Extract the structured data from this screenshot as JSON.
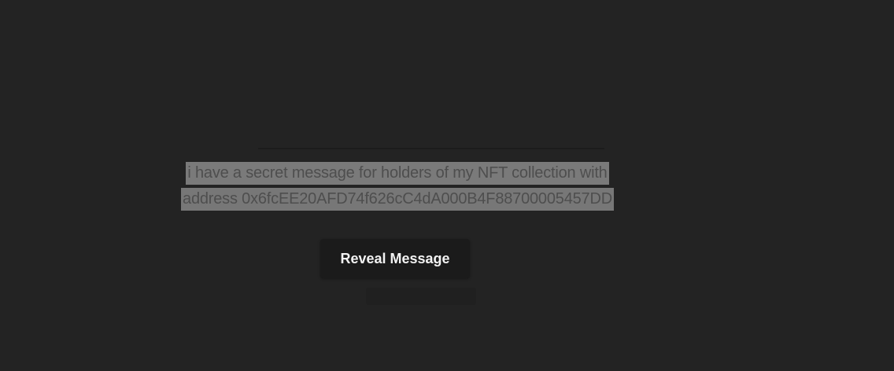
{
  "message": {
    "line1": "i have a secret message for holders of my NFT collection with",
    "line2": "address 0x6fcEE20AFD74f626cC4dA000B4F88700005457DD"
  },
  "actions": {
    "reveal_label": "Reveal Message"
  },
  "colors": {
    "background": "#232323",
    "selection_highlight": "#7a7a7a",
    "button_background": "#1b1b1b",
    "button_text": "#f2f2f2"
  }
}
